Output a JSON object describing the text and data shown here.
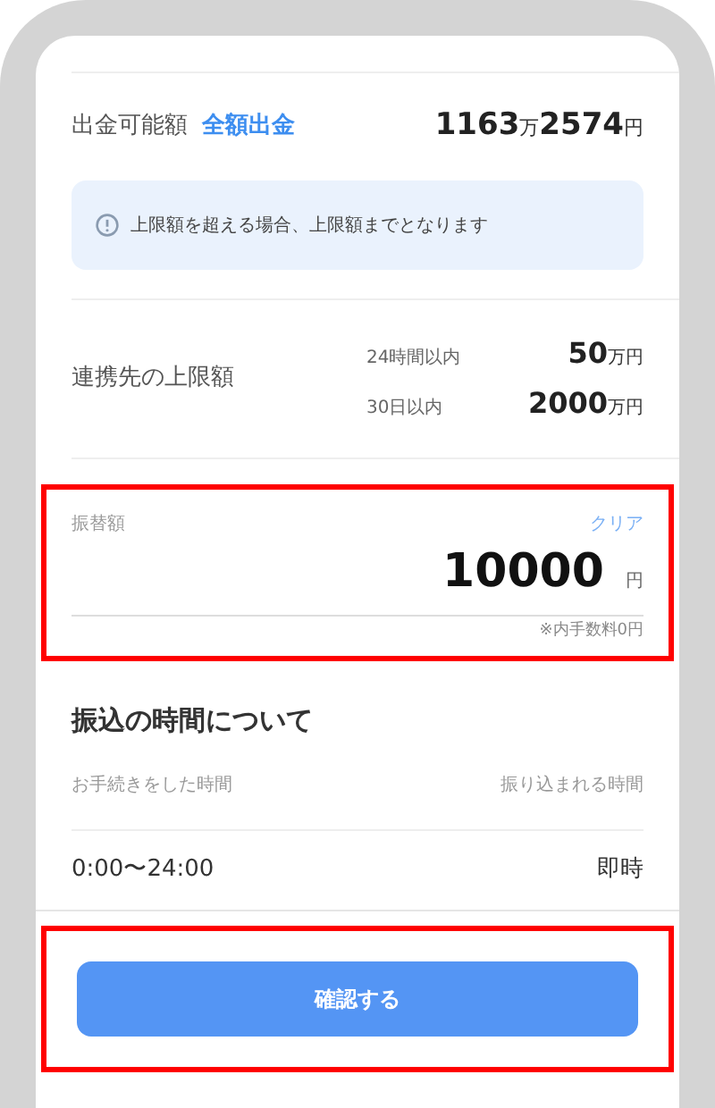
{
  "available": {
    "label": "出金可能額",
    "link": "全額出金",
    "amount": [
      {
        "text": "1163",
        "kind": "number"
      },
      {
        "text": "万",
        "kind": "unit"
      },
      {
        "text": "2574",
        "kind": "number"
      },
      {
        "text": "円",
        "kind": "unit"
      }
    ]
  },
  "notice": "上限額を超える場合、上限額までとなります",
  "limits": {
    "label": "連携先の上限額",
    "rows": [
      {
        "period": "24時間以内",
        "amount": [
          {
            "text": "50",
            "kind": "number"
          },
          {
            "text": "万円",
            "kind": "unit"
          }
        ]
      },
      {
        "period": "30日以内",
        "amount": [
          {
            "text": "2000",
            "kind": "number"
          },
          {
            "text": "万円",
            "kind": "unit"
          }
        ]
      }
    ]
  },
  "transfer": {
    "label": "振替額",
    "clear": "クリア",
    "value": "10000",
    "unit": "円",
    "fee_note": "※内手数料0円",
    "highlighted": true
  },
  "timing": {
    "title": "振込の時間について",
    "columns": [
      "お手続きをした時間",
      "振り込まれる時間"
    ],
    "rows": [
      [
        "0:00〜24:00",
        "即時"
      ]
    ]
  },
  "confirm": {
    "label": "確認する",
    "highlighted": true
  }
}
